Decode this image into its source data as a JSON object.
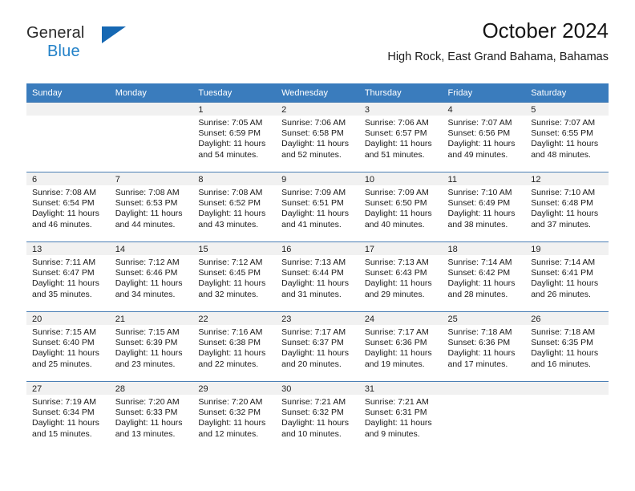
{
  "brand": {
    "line1": "General",
    "line2": "Blue",
    "triangle_icon": "triangle-icon",
    "accent_color": "#2281c8"
  },
  "header": {
    "title": "October 2024",
    "subtitle": "High Rock, East Grand Bahama, Bahamas"
  },
  "theme": {
    "header_row_bg": "#3a7cbd",
    "daynum_bg": "#f1f1f1",
    "cell_border": "#4b7fb5"
  },
  "weekday_headers": [
    "Sunday",
    "Monday",
    "Tuesday",
    "Wednesday",
    "Thursday",
    "Friday",
    "Saturday"
  ],
  "labels": {
    "sunrise_prefix": "Sunrise:",
    "sunset_prefix": "Sunset:",
    "daylight_prefix": "Daylight:"
  },
  "weeks": [
    [
      {
        "day": "",
        "sunrise": "",
        "sunset": "",
        "daylight_line1": "",
        "daylight_line2": ""
      },
      {
        "day": "",
        "sunrise": "",
        "sunset": "",
        "daylight_line1": "",
        "daylight_line2": ""
      },
      {
        "day": "1",
        "sunrise": "Sunrise: 7:05 AM",
        "sunset": "Sunset: 6:59 PM",
        "daylight_line1": "Daylight: 11 hours",
        "daylight_line2": "and 54 minutes."
      },
      {
        "day": "2",
        "sunrise": "Sunrise: 7:06 AM",
        "sunset": "Sunset: 6:58 PM",
        "daylight_line1": "Daylight: 11 hours",
        "daylight_line2": "and 52 minutes."
      },
      {
        "day": "3",
        "sunrise": "Sunrise: 7:06 AM",
        "sunset": "Sunset: 6:57 PM",
        "daylight_line1": "Daylight: 11 hours",
        "daylight_line2": "and 51 minutes."
      },
      {
        "day": "4",
        "sunrise": "Sunrise: 7:07 AM",
        "sunset": "Sunset: 6:56 PM",
        "daylight_line1": "Daylight: 11 hours",
        "daylight_line2": "and 49 minutes."
      },
      {
        "day": "5",
        "sunrise": "Sunrise: 7:07 AM",
        "sunset": "Sunset: 6:55 PM",
        "daylight_line1": "Daylight: 11 hours",
        "daylight_line2": "and 48 minutes."
      }
    ],
    [
      {
        "day": "6",
        "sunrise": "Sunrise: 7:08 AM",
        "sunset": "Sunset: 6:54 PM",
        "daylight_line1": "Daylight: 11 hours",
        "daylight_line2": "and 46 minutes."
      },
      {
        "day": "7",
        "sunrise": "Sunrise: 7:08 AM",
        "sunset": "Sunset: 6:53 PM",
        "daylight_line1": "Daylight: 11 hours",
        "daylight_line2": "and 44 minutes."
      },
      {
        "day": "8",
        "sunrise": "Sunrise: 7:08 AM",
        "sunset": "Sunset: 6:52 PM",
        "daylight_line1": "Daylight: 11 hours",
        "daylight_line2": "and 43 minutes."
      },
      {
        "day": "9",
        "sunrise": "Sunrise: 7:09 AM",
        "sunset": "Sunset: 6:51 PM",
        "daylight_line1": "Daylight: 11 hours",
        "daylight_line2": "and 41 minutes."
      },
      {
        "day": "10",
        "sunrise": "Sunrise: 7:09 AM",
        "sunset": "Sunset: 6:50 PM",
        "daylight_line1": "Daylight: 11 hours",
        "daylight_line2": "and 40 minutes."
      },
      {
        "day": "11",
        "sunrise": "Sunrise: 7:10 AM",
        "sunset": "Sunset: 6:49 PM",
        "daylight_line1": "Daylight: 11 hours",
        "daylight_line2": "and 38 minutes."
      },
      {
        "day": "12",
        "sunrise": "Sunrise: 7:10 AM",
        "sunset": "Sunset: 6:48 PM",
        "daylight_line1": "Daylight: 11 hours",
        "daylight_line2": "and 37 minutes."
      }
    ],
    [
      {
        "day": "13",
        "sunrise": "Sunrise: 7:11 AM",
        "sunset": "Sunset: 6:47 PM",
        "daylight_line1": "Daylight: 11 hours",
        "daylight_line2": "and 35 minutes."
      },
      {
        "day": "14",
        "sunrise": "Sunrise: 7:12 AM",
        "sunset": "Sunset: 6:46 PM",
        "daylight_line1": "Daylight: 11 hours",
        "daylight_line2": "and 34 minutes."
      },
      {
        "day": "15",
        "sunrise": "Sunrise: 7:12 AM",
        "sunset": "Sunset: 6:45 PM",
        "daylight_line1": "Daylight: 11 hours",
        "daylight_line2": "and 32 minutes."
      },
      {
        "day": "16",
        "sunrise": "Sunrise: 7:13 AM",
        "sunset": "Sunset: 6:44 PM",
        "daylight_line1": "Daylight: 11 hours",
        "daylight_line2": "and 31 minutes."
      },
      {
        "day": "17",
        "sunrise": "Sunrise: 7:13 AM",
        "sunset": "Sunset: 6:43 PM",
        "daylight_line1": "Daylight: 11 hours",
        "daylight_line2": "and 29 minutes."
      },
      {
        "day": "18",
        "sunrise": "Sunrise: 7:14 AM",
        "sunset": "Sunset: 6:42 PM",
        "daylight_line1": "Daylight: 11 hours",
        "daylight_line2": "and 28 minutes."
      },
      {
        "day": "19",
        "sunrise": "Sunrise: 7:14 AM",
        "sunset": "Sunset: 6:41 PM",
        "daylight_line1": "Daylight: 11 hours",
        "daylight_line2": "and 26 minutes."
      }
    ],
    [
      {
        "day": "20",
        "sunrise": "Sunrise: 7:15 AM",
        "sunset": "Sunset: 6:40 PM",
        "daylight_line1": "Daylight: 11 hours",
        "daylight_line2": "and 25 minutes."
      },
      {
        "day": "21",
        "sunrise": "Sunrise: 7:15 AM",
        "sunset": "Sunset: 6:39 PM",
        "daylight_line1": "Daylight: 11 hours",
        "daylight_line2": "and 23 minutes."
      },
      {
        "day": "22",
        "sunrise": "Sunrise: 7:16 AM",
        "sunset": "Sunset: 6:38 PM",
        "daylight_line1": "Daylight: 11 hours",
        "daylight_line2": "and 22 minutes."
      },
      {
        "day": "23",
        "sunrise": "Sunrise: 7:17 AM",
        "sunset": "Sunset: 6:37 PM",
        "daylight_line1": "Daylight: 11 hours",
        "daylight_line2": "and 20 minutes."
      },
      {
        "day": "24",
        "sunrise": "Sunrise: 7:17 AM",
        "sunset": "Sunset: 6:36 PM",
        "daylight_line1": "Daylight: 11 hours",
        "daylight_line2": "and 19 minutes."
      },
      {
        "day": "25",
        "sunrise": "Sunrise: 7:18 AM",
        "sunset": "Sunset: 6:36 PM",
        "daylight_line1": "Daylight: 11 hours",
        "daylight_line2": "and 17 minutes."
      },
      {
        "day": "26",
        "sunrise": "Sunrise: 7:18 AM",
        "sunset": "Sunset: 6:35 PM",
        "daylight_line1": "Daylight: 11 hours",
        "daylight_line2": "and 16 minutes."
      }
    ],
    [
      {
        "day": "27",
        "sunrise": "Sunrise: 7:19 AM",
        "sunset": "Sunset: 6:34 PM",
        "daylight_line1": "Daylight: 11 hours",
        "daylight_line2": "and 15 minutes."
      },
      {
        "day": "28",
        "sunrise": "Sunrise: 7:20 AM",
        "sunset": "Sunset: 6:33 PM",
        "daylight_line1": "Daylight: 11 hours",
        "daylight_line2": "and 13 minutes."
      },
      {
        "day": "29",
        "sunrise": "Sunrise: 7:20 AM",
        "sunset": "Sunset: 6:32 PM",
        "daylight_line1": "Daylight: 11 hours",
        "daylight_line2": "and 12 minutes."
      },
      {
        "day": "30",
        "sunrise": "Sunrise: 7:21 AM",
        "sunset": "Sunset: 6:32 PM",
        "daylight_line1": "Daylight: 11 hours",
        "daylight_line2": "and 10 minutes."
      },
      {
        "day": "31",
        "sunrise": "Sunrise: 7:21 AM",
        "sunset": "Sunset: 6:31 PM",
        "daylight_line1": "Daylight: 11 hours",
        "daylight_line2": "and 9 minutes."
      },
      {
        "day": "",
        "sunrise": "",
        "sunset": "",
        "daylight_line1": "",
        "daylight_line2": ""
      },
      {
        "day": "",
        "sunrise": "",
        "sunset": "",
        "daylight_line1": "",
        "daylight_line2": ""
      }
    ]
  ]
}
